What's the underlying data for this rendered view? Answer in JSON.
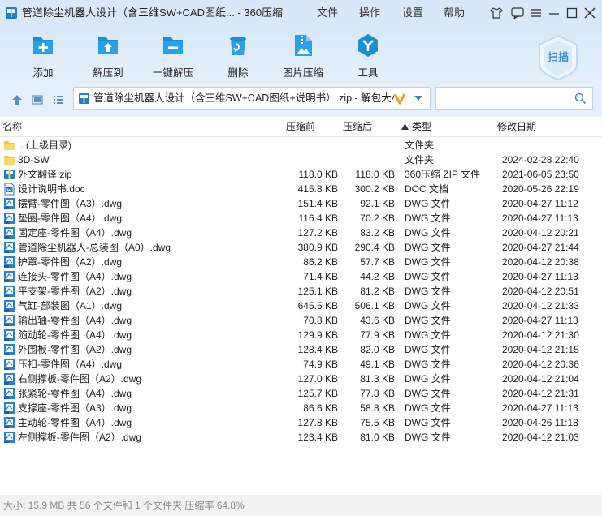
{
  "window": {
    "title": "管道除尘机器人设计（含三维SW+CAD图纸... - 360压缩",
    "menu": [
      "文件",
      "操作",
      "设置",
      "帮助"
    ]
  },
  "toolbar": {
    "add": "添加",
    "extract": "解压到",
    "one_click": "一键解压",
    "delete": "删除",
    "image_compress": "图片压缩",
    "tools": "工具",
    "scan": "扫描"
  },
  "address": {
    "path": "管道除尘机器人设计（含三维SW+CAD图纸+说明书）.zip - 解包大小"
  },
  "columns": {
    "name": "名称",
    "size": "压缩前",
    "packed": "压缩后",
    "type": "类型",
    "date": "修改日期"
  },
  "files": [
    {
      "name": ".. (上级目录)",
      "size": "",
      "packed": "",
      "type": "文件夹",
      "date": "",
      "icon": "folder"
    },
    {
      "name": "3D-SW",
      "size": "",
      "packed": "",
      "type": "文件夹",
      "date": "2024-02-28 22:40",
      "icon": "folder"
    },
    {
      "name": "外文翻译.zip",
      "size": "118.0 KB",
      "packed": "118.0 KB",
      "type": "360压缩 ZIP 文件",
      "date": "2021-06-05 23:50",
      "icon": "zip"
    },
    {
      "name": "设计说明书.doc",
      "size": "415.8 KB",
      "packed": "300.2 KB",
      "type": "DOC 文档",
      "date": "2020-05-26 22:19",
      "icon": "doc"
    },
    {
      "name": "摆臂-零件图（A3）.dwg",
      "size": "151.4 KB",
      "packed": "92.1 KB",
      "type": "DWG 文件",
      "date": "2020-04-27 11:12",
      "icon": "dwg"
    },
    {
      "name": "垫圈-零件图（A4）.dwg",
      "size": "116.4 KB",
      "packed": "70.2 KB",
      "type": "DWG 文件",
      "date": "2020-04-27 11:13",
      "icon": "dwg"
    },
    {
      "name": "固定座-零件图（A4）.dwg",
      "size": "127.2 KB",
      "packed": "83.2 KB",
      "type": "DWG 文件",
      "date": "2020-04-12 20:21",
      "icon": "dwg"
    },
    {
      "name": "管道除尘机器人-总装图（A0）.dwg",
      "size": "380.9 KB",
      "packed": "290.4 KB",
      "type": "DWG 文件",
      "date": "2020-04-27 21:44",
      "icon": "dwg"
    },
    {
      "name": "护罩-零件图（A2）.dwg",
      "size": "86.2 KB",
      "packed": "57.7 KB",
      "type": "DWG 文件",
      "date": "2020-04-12 20:38",
      "icon": "dwg"
    },
    {
      "name": "连接头-零件图（A4）.dwg",
      "size": "71.4 KB",
      "packed": "44.2 KB",
      "type": "DWG 文件",
      "date": "2020-04-27 11:13",
      "icon": "dwg"
    },
    {
      "name": "平支架-零件图（A2）.dwg",
      "size": "125.1 KB",
      "packed": "81.2 KB",
      "type": "DWG 文件",
      "date": "2020-04-12 20:51",
      "icon": "dwg"
    },
    {
      "name": "气缸-部装图（A1）.dwg",
      "size": "645.5 KB",
      "packed": "506.1 KB",
      "type": "DWG 文件",
      "date": "2020-04-12 21:33",
      "icon": "dwg"
    },
    {
      "name": "输出轴-零件图（A4）.dwg",
      "size": "70.8 KB",
      "packed": "43.6 KB",
      "type": "DWG 文件",
      "date": "2020-04-27 11:13",
      "icon": "dwg"
    },
    {
      "name": "随动轮-零件图（A4）.dwg",
      "size": "129.9 KB",
      "packed": "77.9 KB",
      "type": "DWG 文件",
      "date": "2020-04-12 21:30",
      "icon": "dwg"
    },
    {
      "name": "外围板-零件图（A2）.dwg",
      "size": "128.4 KB",
      "packed": "82.0 KB",
      "type": "DWG 文件",
      "date": "2020-04-12 21:15",
      "icon": "dwg"
    },
    {
      "name": "压扣-零件图（A4）.dwg",
      "size": "74.9 KB",
      "packed": "49.1 KB",
      "type": "DWG 文件",
      "date": "2020-04-12 20:36",
      "icon": "dwg"
    },
    {
      "name": "右侧撑板-零件图（A2）.dwg",
      "size": "127.0 KB",
      "packed": "81.3 KB",
      "type": "DWG 文件",
      "date": "2020-04-12 21:04",
      "icon": "dwg"
    },
    {
      "name": "张紧轮-零件图（A4）.dwg",
      "size": "125.7 KB",
      "packed": "77.8 KB",
      "type": "DWG 文件",
      "date": "2020-04-12 21:31",
      "icon": "dwg"
    },
    {
      "name": "支撑座-零件图（A3）.dwg",
      "size": "86.6 KB",
      "packed": "58.8 KB",
      "type": "DWG 文件",
      "date": "2020-04-27 11:13",
      "icon": "dwg"
    },
    {
      "name": "主动轮-零件图（A4）.dwg",
      "size": "127.8 KB",
      "packed": "75.5 KB",
      "type": "DWG 文件",
      "date": "2020-04-26 11:18",
      "icon": "dwg"
    },
    {
      "name": "左侧撑板-零件图（A2）.dwg",
      "size": "123.4 KB",
      "packed": "81.0 KB",
      "type": "DWG 文件",
      "date": "2020-04-12 21:03",
      "icon": "dwg"
    }
  ],
  "status": {
    "text": "大小: 15.9 MB 共 56 个文件和 1 个文件夹 压缩率 64.8%"
  },
  "colors": {
    "toolbar_bg": "#d8e8f8",
    "icon_blue": "#1a8fd9",
    "folder_yellow": "#f5c842"
  }
}
